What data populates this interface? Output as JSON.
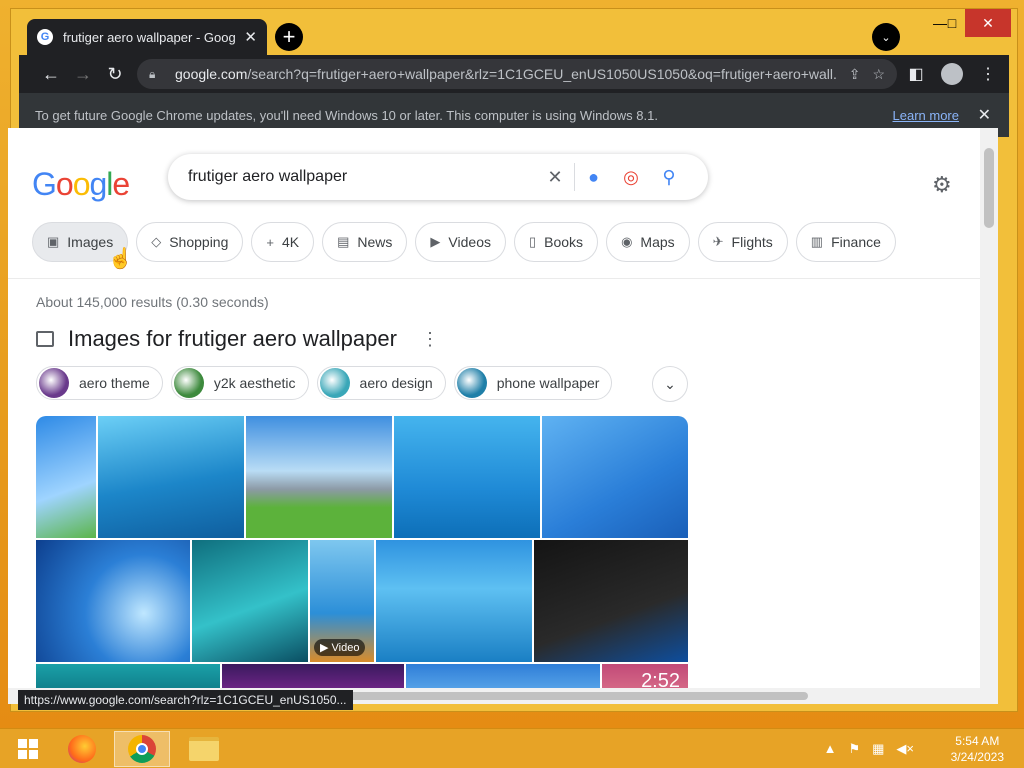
{
  "window": {
    "tab_title": "frutiger aero wallpaper - Google",
    "tab_favicon": "G",
    "new_tab": "+",
    "minimize": "—",
    "maximize": "□",
    "close": "✕"
  },
  "toolbar": {
    "url_host": "google.com",
    "url_rest": "/search?q=frutiger+aero+wallpaper&rlz=1C1GCEU_enUS1050US1050&oq=frutiger+aero+wall..."
  },
  "infobar": {
    "message": "To get future Google Chrome updates, you'll need Windows 10 or later. This computer is using Windows 8.1.",
    "link": "Learn more"
  },
  "search": {
    "logo": [
      "G",
      "o",
      "o",
      "g",
      "l",
      "e"
    ],
    "logo_colors": [
      "#4285f4",
      "#ea4335",
      "#fbbc05",
      "#4285f4",
      "#34a853",
      "#ea4335"
    ],
    "query": "frutiger aero wallpaper"
  },
  "chips": [
    {
      "label": "Images",
      "icon": "image-icon",
      "glyph": "▣"
    },
    {
      "label": "Shopping",
      "icon": "tag-icon",
      "glyph": "◇"
    },
    {
      "label": "4K",
      "icon": "plus-icon",
      "glyph": "+"
    },
    {
      "label": "News",
      "icon": "news-icon",
      "glyph": "▤"
    },
    {
      "label": "Videos",
      "icon": "video-icon",
      "glyph": "▶"
    },
    {
      "label": "Books",
      "icon": "book-icon",
      "glyph": "▯"
    },
    {
      "label": "Maps",
      "icon": "map-pin-icon",
      "glyph": "◉"
    },
    {
      "label": "Flights",
      "icon": "plane-icon",
      "glyph": "✈"
    },
    {
      "label": "Finance",
      "icon": "finance-icon",
      "glyph": "▥"
    }
  ],
  "results": {
    "stats": "About 145,000 results (0.30 seconds)",
    "images_heading": "Images for frutiger aero wallpaper"
  },
  "related": [
    {
      "label": "aero theme",
      "color": "#6a3a8c"
    },
    {
      "label": "y2k aesthetic",
      "color": "#3d8a3d"
    },
    {
      "label": "aero design",
      "color": "#3aa7b8"
    },
    {
      "label": "phone wallpaper",
      "color": "#1f7fa8"
    }
  ],
  "images": {
    "video_badge": "▶ Video",
    "clock_text": "2:52"
  },
  "statusbar": {
    "url": "https://www.google.com/search?rlz=1C1GCEU_enUS1050..."
  },
  "taskbar": {
    "time": "5:54 AM",
    "date": "3/24/2023"
  }
}
